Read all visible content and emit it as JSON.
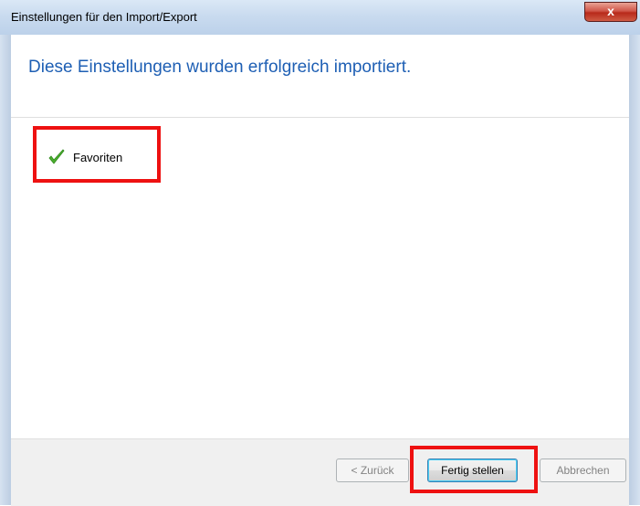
{
  "window": {
    "title": "Einstellungen für den Import/Export",
    "close_label": "x"
  },
  "header": {
    "heading": "Diese Einstellungen wurden erfolgreich importiert."
  },
  "imported_items": [
    {
      "label": "Favoriten",
      "icon": "checkmark-icon",
      "status": "success"
    }
  ],
  "footer": {
    "back_label": "< Zurück",
    "finish_label": "Fertig stellen",
    "cancel_label": "Abbrechen"
  },
  "colors": {
    "heading": "#1e5fb4",
    "check": "#4caf2e",
    "highlight": "#ee1111"
  }
}
